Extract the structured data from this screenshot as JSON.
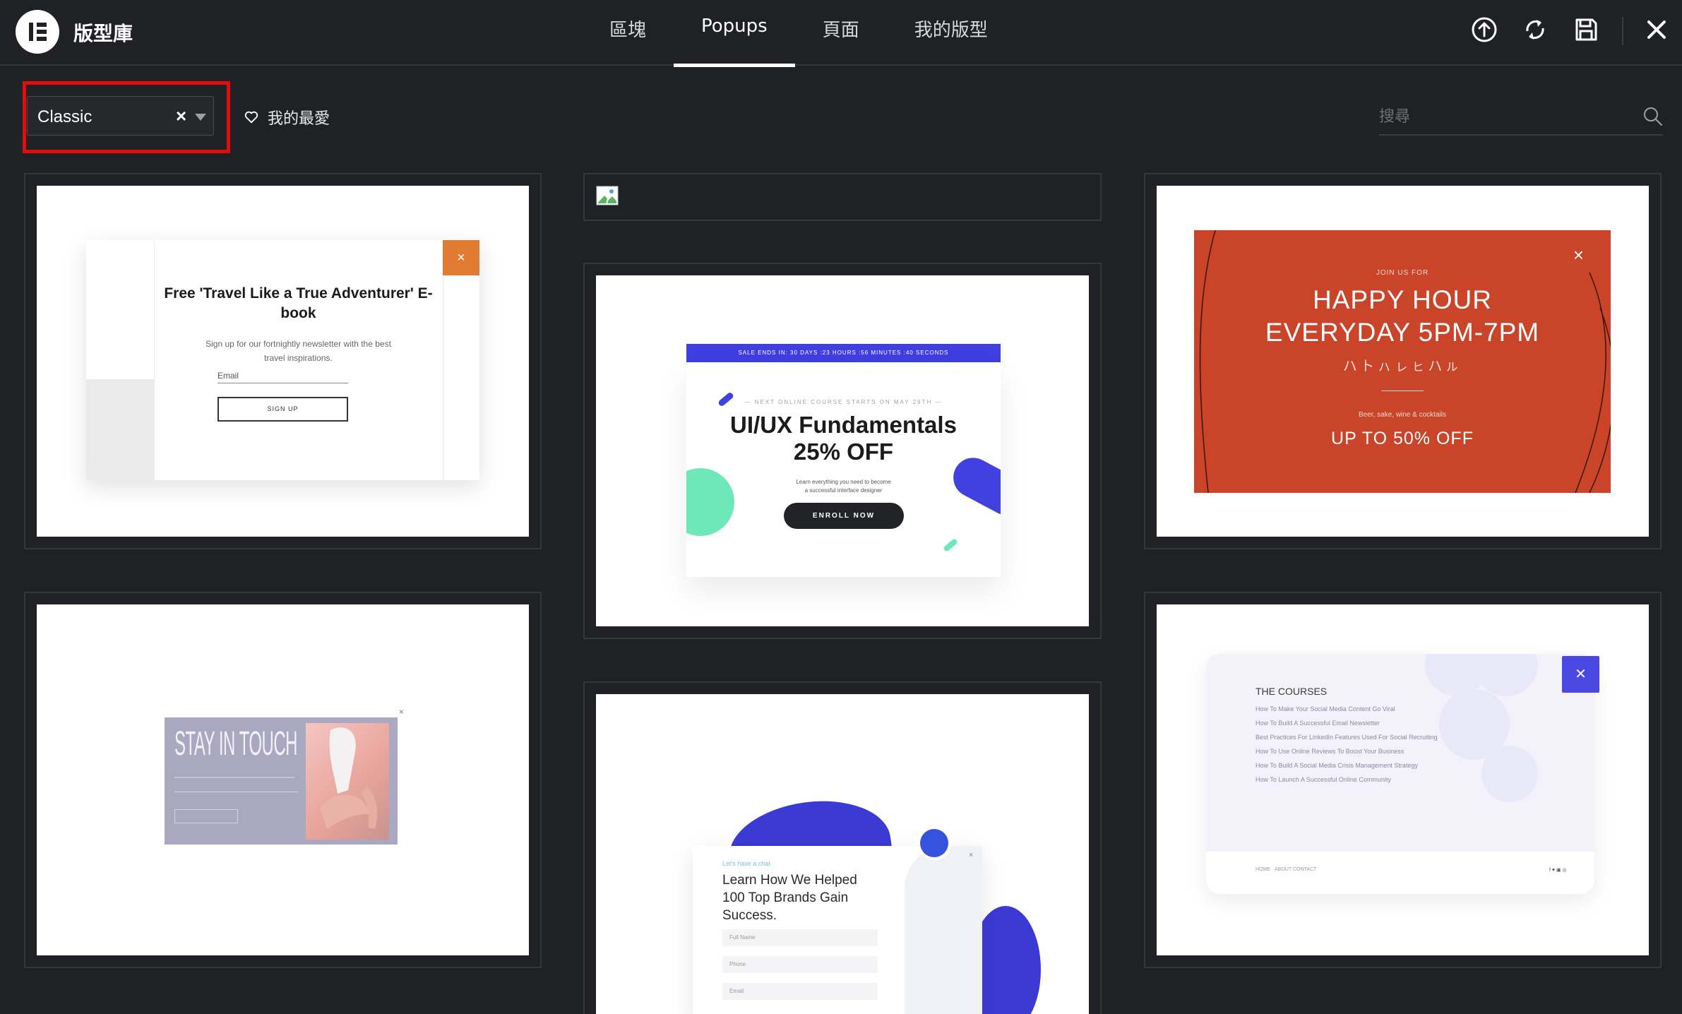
{
  "header": {
    "brand": "版型庫",
    "tabs": [
      {
        "label": "區塊"
      },
      {
        "label": "Popups"
      },
      {
        "label": "頁面"
      },
      {
        "label": "我的版型"
      }
    ],
    "active_tab": "Popups",
    "icons": [
      "upload-icon",
      "sync-icon",
      "save-icon",
      "close-icon"
    ]
  },
  "filter": {
    "selected": "Classic",
    "clear_glyph": "×",
    "favorites_label": "我的最愛",
    "search_placeholder": "搜尋"
  },
  "templates": {
    "t1": {
      "title": "Free 'Travel Like a True Adventurer' E-book",
      "subtitle": "Sign up for our fortnightly newsletter with the best travel inspirations.",
      "field": "Email",
      "button": "SIGN UP",
      "close": "×"
    },
    "t3": {
      "kicker": "JOIN US FOR",
      "title_line1": "HAPPY HOUR",
      "title_line2": "EVERYDAY 5PM-7PM",
      "script": "ハトㇵㇾㇶハㇽ",
      "small": "Beer, sake, wine & cocktails",
      "offer": "UP TO 50% OFF",
      "close": "×"
    },
    "t4": {
      "title": "STAY IN TOUCH",
      "close": "×"
    },
    "t5": {
      "banner": "SALE ENDS IN: 30 DAYS :23 HOURS :56 MINUTES :40 SECONDS",
      "kicker": "— NEXT ONLINE COURSE STARTS ON MAY 29TH —",
      "title_line1": "UI/UX Fundamentals",
      "title_line2": "25% OFF",
      "subtitle_line1": "Learn everything you need to become",
      "subtitle_line2": "a successful interface designer",
      "button": "ENROLL NOW"
    },
    "t6": {
      "kicker": "Let's have a chat",
      "title_line1": "Learn How We Helped",
      "title_line2": "100 Top Brands Gain",
      "title_line3": "Success.",
      "fields": [
        "Full Name",
        "Phone",
        "Email"
      ],
      "close": "×"
    },
    "t7": {
      "title": "THE COURSES",
      "items": [
        "How To Make Your Social Media Content Go Viral",
        "How To Build A Successful Email Newsletter",
        "Best Practices For LinkedIn Features Used For Social Recruiting",
        "How To Use Online Reviews To Boost Your Business",
        "How To Build A Social Media Crisis Management Strategy",
        "How To Launch A Successful Online Community"
      ],
      "footer_links": [
        "HOME",
        "ABOUT",
        "CONTACT"
      ],
      "social": "f ♥ ▣ ◎",
      "close": "✕"
    }
  },
  "colors": {
    "background": "#1f2124",
    "highlight_border": "#e30c0c",
    "t1_accent": "#e17b32",
    "t3_background": "#c94428",
    "t5_accent": "#3e3ee3",
    "t5_mint": "#6ee8b8",
    "t7_accent": "#4a48e2"
  }
}
